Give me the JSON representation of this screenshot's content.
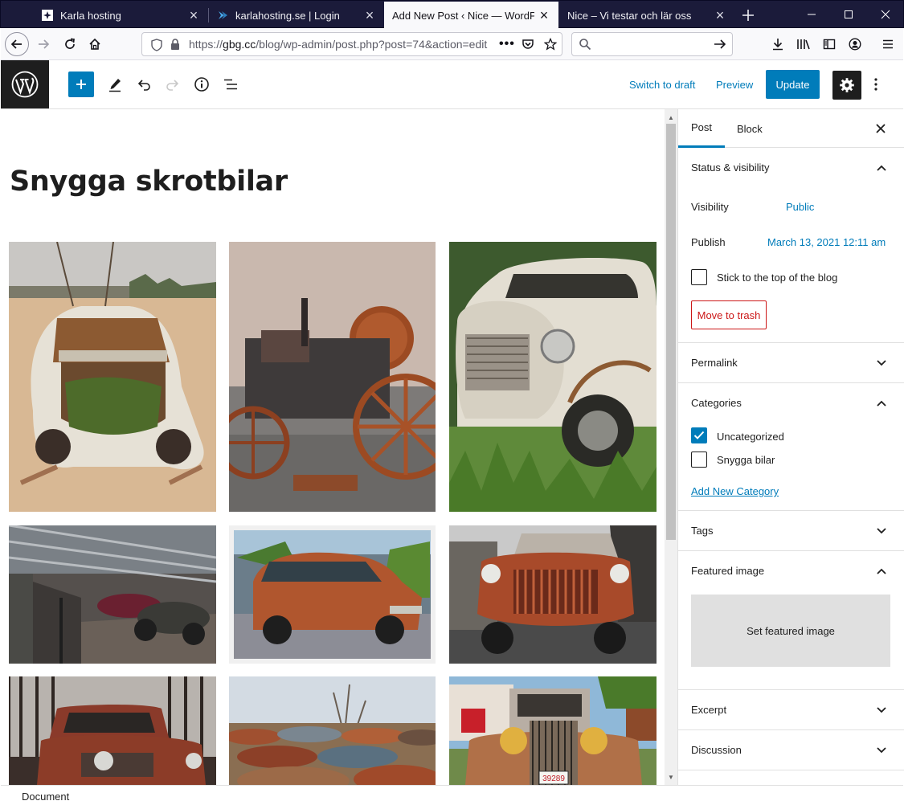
{
  "browser": {
    "tabs": [
      {
        "title": "Karla hosting",
        "icon": "karla-hosting-favicon",
        "active": false
      },
      {
        "title": "karlahosting.se | Login",
        "icon": "karlahosting-login-favicon",
        "active": false
      },
      {
        "title": "Add New Post ‹ Nice — WordPress",
        "icon": "",
        "active": true
      },
      {
        "title": "Nice – Vi testar och lär oss",
        "icon": "",
        "active": false
      }
    ],
    "url_prefix": "https://",
    "url_domain": "gbg.cc",
    "url_path": "/blog/wp-admin/post.php?post=74&action=edit",
    "search_placeholder": ""
  },
  "toolbar": {
    "switch_to_draft": "Switch to draft",
    "preview": "Preview",
    "update": "Update"
  },
  "post": {
    "title": "Snygga skrotbilar",
    "gallery": [
      {
        "subject": "rusty-beetle-desert",
        "sky": "#c9c7c4",
        "ground": "#d8b894"
      },
      {
        "subject": "rusty-traction-engine",
        "sky": "#c9b8ae",
        "ground": "#7d7a78"
      },
      {
        "subject": "white-rusty-truck-grass",
        "sky": "#3d5a2e",
        "ground": "#5f8a3a"
      },
      {
        "subject": "car-museum-hall",
        "sky": "#7a8086",
        "ground": "#55504d"
      },
      {
        "subject": "rusty-station-wagon",
        "sky": "#6b7d8a",
        "ground": "#8c8d96"
      },
      {
        "subject": "rusty-red-truck-front",
        "sky": "#c9c9c9",
        "ground": "#4a4a4a"
      },
      {
        "subject": "red-truck-forest",
        "sky": "#b8b3ae",
        "ground": "#3a2e2a"
      },
      {
        "subject": "scrapyard-cars",
        "sky": "#d3dbe3",
        "ground": "#8a6e52"
      },
      {
        "subject": "vintage-car-plate",
        "sky": "#8fb8d8",
        "ground": "#6f8a4a"
      }
    ],
    "plate_text": "39289"
  },
  "sidebar": {
    "tabs": [
      "Post",
      "Block"
    ],
    "status_visibility": "Status & visibility",
    "visibility_label": "Visibility",
    "visibility_value": "Public",
    "publish_label": "Publish",
    "publish_value": "March 13, 2021 12:11 am",
    "sticky_label": "Stick to the top of the blog",
    "move_to_trash": "Move to trash",
    "permalink": "Permalink",
    "categories": "Categories",
    "category_items": [
      {
        "label": "Uncategorized",
        "checked": true
      },
      {
        "label": "Snygga bilar",
        "checked": false
      }
    ],
    "add_new_category": "Add New Category",
    "tags": "Tags",
    "featured_image": "Featured image",
    "set_featured_image": "Set featured image",
    "excerpt": "Excerpt",
    "discussion": "Discussion"
  },
  "footer": {
    "breadcrumb": "Document"
  },
  "colors": {
    "accent": "#007cba",
    "danger": "#cc1818",
    "dark": "#1e1e1e",
    "tab_strip": "#1b1b3a"
  }
}
